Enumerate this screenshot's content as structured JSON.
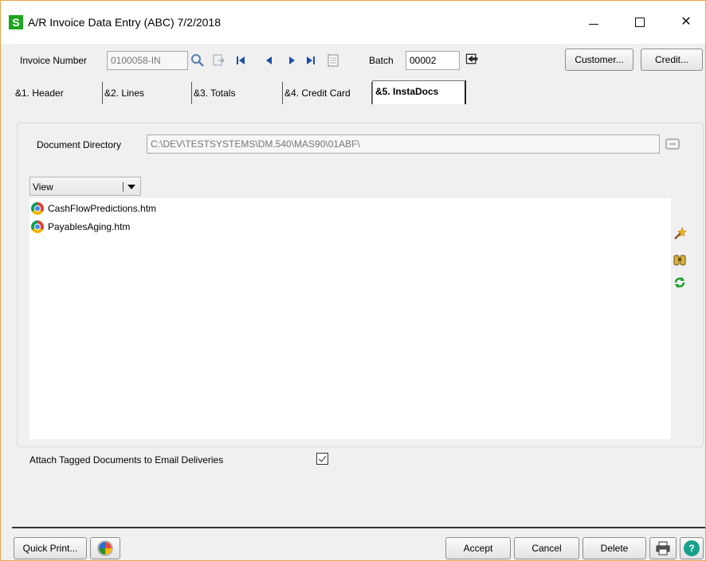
{
  "window": {
    "app_icon": "S",
    "title": "A/R Invoice Data Entry (ABC) 7/2/2018"
  },
  "toolbar": {
    "invoice_label": "Invoice Number",
    "invoice_value": "0100058-IN",
    "batch_label": "Batch",
    "batch_value": "00002",
    "customer_label": "Customer...",
    "credit_label": "Credit..."
  },
  "tabs": [
    {
      "label": "&1. Header"
    },
    {
      "label": "&2. Lines"
    },
    {
      "label": "&3. Totals"
    },
    {
      "label": "&4. Credit Card"
    },
    {
      "label": "&5. InstaDocs",
      "selected": true
    }
  ],
  "instadocs": {
    "directory_label": "Document Directory",
    "directory_value": "C:\\DEV\\TESTSYSTEMS\\DM.540\\MAS90\\01ABF\\",
    "view_label": "View",
    "documents": [
      {
        "name": "CashFlowPredictions.htm",
        "icon": "chrome-icon"
      },
      {
        "name": "PayablesAging.htm",
        "icon": "chrome-icon"
      }
    ],
    "attach_label": "Attach Tagged Documents to Email Deliveries",
    "attach_checked": true
  },
  "footer": {
    "quick_print_label": "Quick Print...",
    "accept_label": "Accept",
    "cancel_label": "Cancel",
    "delete_label": "Delete"
  },
  "colors": {
    "app_icon": "#1fa51f",
    "window_border": "#e8a54b"
  }
}
